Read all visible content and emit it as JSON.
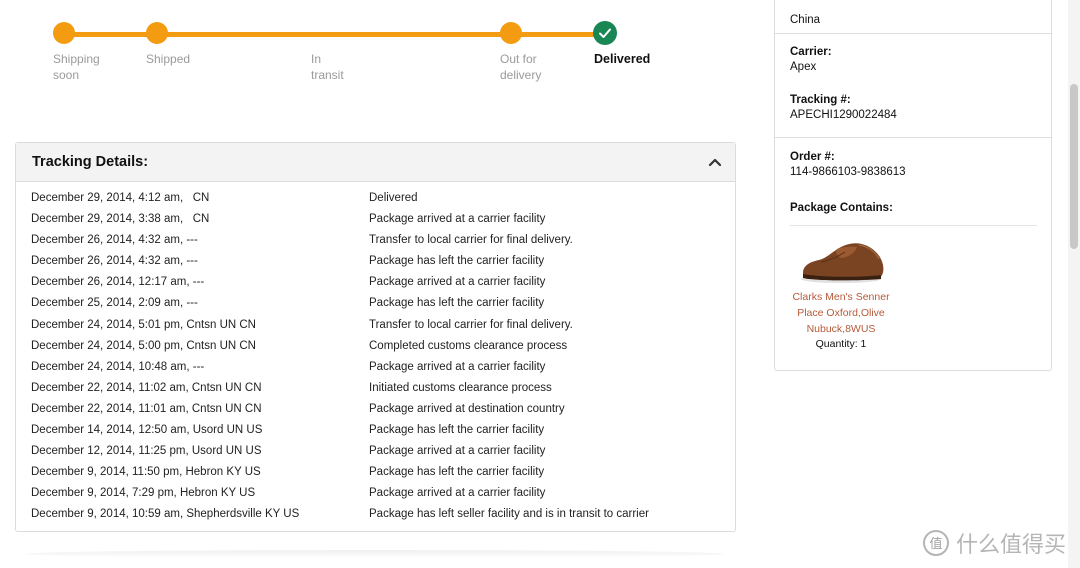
{
  "progress": {
    "stages": [
      {
        "label": "Shipping soon"
      },
      {
        "label": "Shipped"
      },
      {
        "label": "In transit"
      },
      {
        "label": "Out for delivery"
      },
      {
        "label": "Delivered"
      }
    ],
    "current_stage_index": 4,
    "colors": {
      "track": "#f39c12",
      "done": "#198754"
    }
  },
  "tracking": {
    "title": "Tracking Details:",
    "events": [
      {
        "time": "December 29, 2014, 4:12 am,   CN",
        "event": "Delivered"
      },
      {
        "time": "December 29, 2014, 3:38 am,   CN",
        "event": "Package arrived at a carrier facility"
      },
      {
        "time": "December 26, 2014, 4:32 am, ---",
        "event": "Transfer to local carrier for final delivery."
      },
      {
        "time": "December 26, 2014, 4:32 am, ---",
        "event": "Package has left the carrier facility"
      },
      {
        "time": "December 26, 2014, 12:17 am, ---",
        "event": "Package arrived at a carrier facility"
      },
      {
        "time": "December 25, 2014, 2:09 am, ---",
        "event": "Package has left the carrier facility"
      },
      {
        "time": "December 24, 2014, 5:01 pm, Cntsn UN CN",
        "event": "Transfer to local carrier for final delivery."
      },
      {
        "time": "December 24, 2014, 5:00 pm, Cntsn UN CN",
        "event": "Completed customs clearance process"
      },
      {
        "time": "December 24, 2014, 10:48 am, ---",
        "event": "Package arrived at a carrier facility"
      },
      {
        "time": "December 22, 2014, 11:02 am, Cntsn UN CN",
        "event": "Initiated customs clearance process"
      },
      {
        "time": "December 22, 2014, 11:01 am, Cntsn UN CN",
        "event": "Package arrived at destination country"
      },
      {
        "time": "December 14, 2014, 12:50 am, Usord UN US",
        "event": "Package has left the carrier facility"
      },
      {
        "time": "December 12, 2014, 11:25 pm, Usord UN US",
        "event": "Package arrived at a carrier facility"
      },
      {
        "time": "December 9, 2014, 11:50 pm, Hebron KY US",
        "event": "Package has left the carrier facility"
      },
      {
        "time": "December 9, 2014, 7:29 pm, Hebron KY US",
        "event": "Package arrived at a carrier facility"
      },
      {
        "time": "December 9, 2014, 10:59 am, Shepherdsville KY US",
        "event": "Package has left seller facility and is in transit to carrier"
      }
    ]
  },
  "sidebar": {
    "destination_country": "China",
    "carrier_label": "Carrier:",
    "carrier": "Apex",
    "tracking_label": "Tracking #:",
    "tracking_number": "APECHI1290022484",
    "order_label": "Order #:",
    "order_number": "114-9866103-9838613",
    "contains_label": "Package Contains:",
    "product_name": "Clarks Men's Senner Place Oxford,Olive Nubuck,8WUS",
    "quantity": "Quantity: 1"
  },
  "watermark": {
    "text": "什么值得买"
  }
}
